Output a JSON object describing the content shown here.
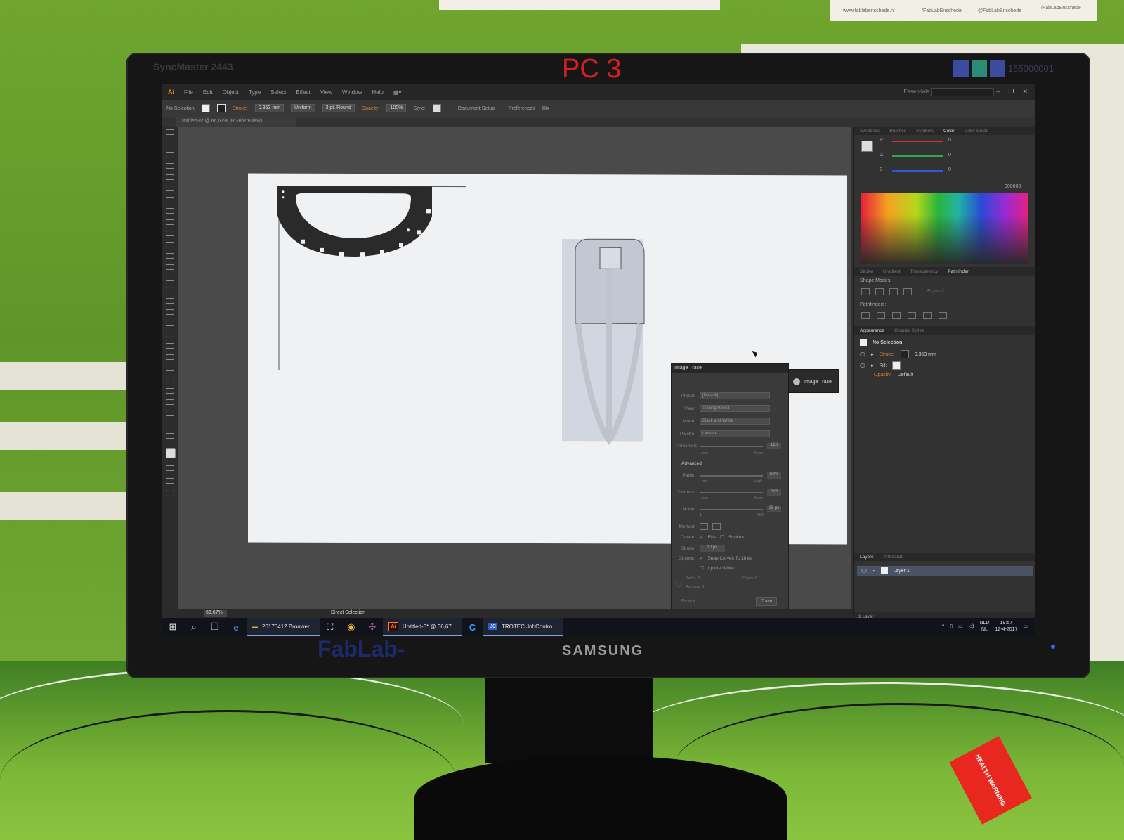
{
  "wall": {
    "note_top_right_texts": [
      "www.fablabenschede.nl",
      "/FabLabEnschede",
      "@FabLabEnschede",
      "/FabLabEnschede"
    ]
  },
  "monitor": {
    "model": "SyncMaster 2443",
    "pc_label": "PC 3",
    "brand": "SAMSUNG",
    "sticker": "FabLab-",
    "serial": "155000001"
  },
  "app": {
    "logo": "Ai",
    "menu": [
      "File",
      "Edit",
      "Object",
      "Type",
      "Select",
      "Effect",
      "View",
      "Window",
      "Help"
    ],
    "essentials_label": "Essentials",
    "control_bar": {
      "selection": "No Selection",
      "stroke_label": "Stroke:",
      "stroke_value": "0.353 mm",
      "profile": "Uniform",
      "brush": "3 pt. Round",
      "opacity_label": "Opacity:",
      "opacity_value": "100%",
      "style_label": "Style:",
      "document_setup": "Document Setup",
      "preferences": "Preferences"
    },
    "document_tab": "Untitled-6* @ 66,67% (RGB/Preview)",
    "status_bar": {
      "zoom": "66,67%",
      "tool": "Direct Selection"
    }
  },
  "color_panel": {
    "tabs": [
      "Swatches",
      "Brushes",
      "Symbols",
      "Color",
      "Color Guide"
    ],
    "active_tab": "Color",
    "channels": [
      "R",
      "G",
      "B"
    ],
    "values": [
      "0",
      "0",
      "0"
    ],
    "hex": "000000",
    "channel_colors": [
      "#d23232",
      "#2ea84a",
      "#2a58d6"
    ]
  },
  "pathfinder_panel": {
    "tabs": [
      "Stroke",
      "Gradient",
      "Transparency",
      "Pathfinder"
    ],
    "active_tab": "Pathfinder",
    "shape_modes_label": "Shape Modes:",
    "expand_button": "Expand",
    "pathfinders_label": "Pathfinders:"
  },
  "appearance_panel": {
    "tabs": [
      "Appearance",
      "Graphic Styles"
    ],
    "active_tab": "Appearance",
    "title": "No Selection",
    "rows": [
      {
        "label": "Stroke:",
        "value": "0.353 mm"
      },
      {
        "label": "Fill:",
        "value": ""
      },
      {
        "label": "Opacity:",
        "value": "Default"
      }
    ]
  },
  "layers_panel": {
    "tabs": [
      "Layers",
      "Artboards"
    ],
    "active_tab": "Layers",
    "layers": [
      "Layer 1"
    ],
    "footer": "1 Layer"
  },
  "image_trace": {
    "title": "Image Trace",
    "popout_label": "Image Trace",
    "rows": [
      {
        "label": "Preset:",
        "value": "[Default]"
      },
      {
        "label": "View:",
        "value": "Tracing Result"
      },
      {
        "label": "Mode:",
        "value": "Black and White"
      },
      {
        "label": "Palette:",
        "value": "Limited"
      }
    ],
    "threshold_label": "Threshold:",
    "threshold_value": "128",
    "threshold_min": "Less",
    "threshold_max": "More",
    "advanced_label": "Advanced",
    "paths_label": "Paths:",
    "paths_value": "50%",
    "paths_min": "Low",
    "paths_max": "High",
    "corners_label": "Corners:",
    "corners_value": "75%",
    "corners_min": "Less",
    "corners_max": "More",
    "noise_label": "Noise:",
    "noise_value": "25 px",
    "noise_min": "1",
    "noise_max": "100",
    "method_label": "Method:",
    "create_label": "Create:",
    "create_fills": "Fills",
    "create_strokes": "Strokes",
    "stroke_label": "Stroke:",
    "stroke_value": "10 px",
    "options_label": "Options:",
    "option_snap": "Snap Curves To Lines",
    "option_ignore": "Ignore White",
    "stats_paths": "Paths:  0",
    "stats_anchors": "Anchors:  0",
    "stats_colors": "Colors:  0",
    "preview_label": "Preview",
    "trace_button": "Trace"
  },
  "taskbar": {
    "apps": [
      {
        "label": "20170412 Brouwer..."
      },
      {
        "label": "Untitled-6* @ 66,67..."
      },
      {
        "label": "TROTEC JobContro..."
      }
    ],
    "language": "NLD",
    "language_sub": "NL",
    "time": "19:57",
    "date": "12-4-2017"
  },
  "warning_sticker": "HEALTH WARNING"
}
